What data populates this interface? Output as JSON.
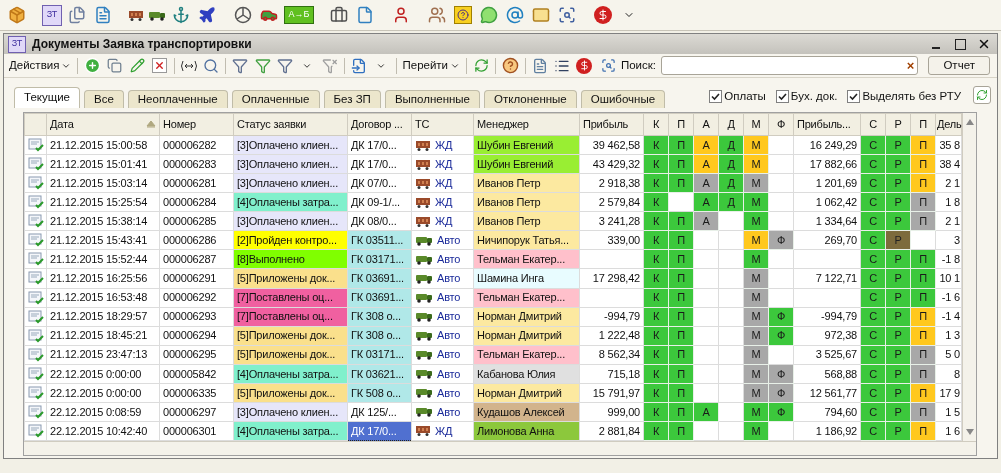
{
  "app_toolbar": {
    "doc_icon_label": "ЗТ",
    "route_icon_label": "А→Б"
  },
  "window": {
    "icon_label": "ЗТ",
    "title": "Документы Заявка транспортировки"
  },
  "toolbar": {
    "actions_menu": "Действия",
    "goto_menu": "Перейти",
    "search_label": "Поиск:",
    "search_clear": "×",
    "report_button": "Отчет"
  },
  "tabs": [
    {
      "label": "Текущие",
      "selected": true
    },
    {
      "label": "Все",
      "selected": false
    },
    {
      "label": "Неоплаченные",
      "selected": false
    },
    {
      "label": "Оплаченные",
      "selected": false
    },
    {
      "label": "Без ЗП",
      "selected": false
    },
    {
      "label": "Выполненные",
      "selected": false
    },
    {
      "label": "Отклоненные",
      "selected": false
    },
    {
      "label": "Ошибочные",
      "selected": false
    }
  ],
  "options": [
    {
      "label": "Оплаты",
      "checked": true
    },
    {
      "label": "Бух. док.",
      "checked": true
    },
    {
      "label": "Выделять без РТУ",
      "checked": true
    }
  ],
  "table": {
    "columns": [
      "Дата",
      "Номер",
      "Статус заявки",
      "Договор ...",
      "ТС",
      "Менеджер",
      "Прибыль",
      "К",
      "П",
      "А",
      "Д",
      "М",
      "Ф",
      "Прибыль...",
      "С",
      "Р",
      "П",
      "Дель"
    ],
    "rows": [
      {
        "date": "21.12.2015 15:00:58",
        "number": "000006282",
        "status": {
          "text": "[3]Оплачено клиен...",
          "color": "#e6e6fa"
        },
        "contract": {
          "text": "ДК 17/0...",
          "color": "#ffffff"
        },
        "transport": {
          "kind": "rail",
          "text": "ЖД"
        },
        "manager": {
          "text": "Шубин Евгений",
          "color": "#99ee33"
        },
        "profit": "39 462,58",
        "flags": [
          {
            "on": true,
            "text": "К",
            "color": "#3cc83c"
          },
          {
            "on": true,
            "text": "П",
            "color": "#3cc83c"
          },
          {
            "on": true,
            "text": "А",
            "color": "#ffc81e"
          },
          {
            "on": true,
            "text": "Д",
            "color": "#3cc83c"
          },
          {
            "on": true,
            "text": "М",
            "color": "#ffc81e"
          },
          {
            "on": false
          }
        ],
        "profit_2": "16 249,29",
        "flags_2": [
          {
            "on": true,
            "text": "С",
            "color": "#3cc83c"
          },
          {
            "on": true,
            "text": "Р",
            "color": "#3cc83c"
          },
          {
            "on": true,
            "text": "П",
            "color": "#ffc81e"
          }
        ],
        "last_column": "35 8",
        "selected": false
      },
      {
        "date": "21.12.2015 15:01:41",
        "number": "000006283",
        "status": {
          "text": "[3]Оплачено клиен...",
          "color": "#e6e6fa"
        },
        "contract": {
          "text": "ДК 17/0...",
          "color": "#ffffff"
        },
        "transport": {
          "kind": "rail",
          "text": "ЖД"
        },
        "manager": {
          "text": "Шубин Евгений",
          "color": "#99ee33"
        },
        "profit": "43 429,32",
        "flags": [
          {
            "on": true,
            "text": "К",
            "color": "#3cc83c"
          },
          {
            "on": true,
            "text": "П",
            "color": "#3cc83c"
          },
          {
            "on": true,
            "text": "А",
            "color": "#ffc81e"
          },
          {
            "on": true,
            "text": "Д",
            "color": "#3cc83c"
          },
          {
            "on": true,
            "text": "М",
            "color": "#ffc81e"
          },
          {
            "on": false
          }
        ],
        "profit_2": "17 882,66",
        "flags_2": [
          {
            "on": true,
            "text": "С",
            "color": "#3cc83c"
          },
          {
            "on": true,
            "text": "Р",
            "color": "#3cc83c"
          },
          {
            "on": true,
            "text": "П",
            "color": "#ffc81e"
          }
        ],
        "last_column": "38 4",
        "selected": false
      },
      {
        "date": "21.12.2015 15:03:14",
        "number": "000006281",
        "status": {
          "text": "[3]Оплачено клиен...",
          "color": "#e6e6fa"
        },
        "contract": {
          "text": "ДК 07/0...",
          "color": "#ffffff"
        },
        "transport": {
          "kind": "rail",
          "text": "ЖД"
        },
        "manager": {
          "text": "Иванов Петр",
          "color": "#fce9a0"
        },
        "profit": "2 918,38",
        "flags": [
          {
            "on": true,
            "text": "К",
            "color": "#3cc83c"
          },
          {
            "on": true,
            "text": "П",
            "color": "#3cc83c"
          },
          {
            "on": true,
            "text": "А",
            "color": "#a8a8a8"
          },
          {
            "on": true,
            "text": "Д",
            "color": "#3cc83c"
          },
          {
            "on": true,
            "text": "М",
            "color": "#a8a8a8"
          },
          {
            "on": false
          }
        ],
        "profit_2": "1 201,69",
        "flags_2": [
          {
            "on": true,
            "text": "С",
            "color": "#3cc83c"
          },
          {
            "on": true,
            "text": "Р",
            "color": "#3cc83c"
          },
          {
            "on": true,
            "text": "П",
            "color": "#ffc81e"
          }
        ],
        "last_column": "2 1",
        "selected": false
      },
      {
        "date": "21.12.2015 15:25:54",
        "number": "000006284",
        "status": {
          "text": "[4]Оплачены затра...",
          "color": "#80f0cc"
        },
        "contract": {
          "text": "ДК 09-1/...",
          "color": "#ffffff"
        },
        "transport": {
          "kind": "rail",
          "text": "ЖД"
        },
        "manager": {
          "text": "Иванов Петр",
          "color": "#fce9a0"
        },
        "profit": "2 579,84",
        "flags": [
          {
            "on": true,
            "text": "К",
            "color": "#3cc83c"
          },
          {
            "on": false
          },
          {
            "on": true,
            "text": "А",
            "color": "#3cc83c"
          },
          {
            "on": true,
            "text": "Д",
            "color": "#3cc83c"
          },
          {
            "on": true,
            "text": "М",
            "color": "#3cc83c"
          },
          {
            "on": false
          }
        ],
        "profit_2": "1 062,42",
        "flags_2": [
          {
            "on": true,
            "text": "С",
            "color": "#3cc83c"
          },
          {
            "on": true,
            "text": "Р",
            "color": "#3cc83c"
          },
          {
            "on": true,
            "text": "П",
            "color": "#a8a8a8"
          }
        ],
        "last_column": "1 8",
        "selected": false
      },
      {
        "date": "21.12.2015 15:38:14",
        "number": "000006285",
        "status": {
          "text": "[3]Оплачено клиен...",
          "color": "#e6e6fa"
        },
        "contract": {
          "text": "ДК 08/0...",
          "color": "#ffffff"
        },
        "transport": {
          "kind": "rail",
          "text": "ЖД"
        },
        "manager": {
          "text": "Иванов Петр",
          "color": "#fce9a0"
        },
        "profit": "3 241,28",
        "flags": [
          {
            "on": true,
            "text": "К",
            "color": "#3cc83c"
          },
          {
            "on": true,
            "text": "П",
            "color": "#3cc83c"
          },
          {
            "on": true,
            "text": "А",
            "color": "#a8a8a8"
          },
          {
            "on": false
          },
          {
            "on": true,
            "text": "М",
            "color": "#3cc83c"
          },
          {
            "on": false
          }
        ],
        "profit_2": "1 334,64",
        "flags_2": [
          {
            "on": true,
            "text": "С",
            "color": "#3cc83c"
          },
          {
            "on": true,
            "text": "Р",
            "color": "#3cc83c"
          },
          {
            "on": true,
            "text": "П",
            "color": "#a8a8a8"
          }
        ],
        "last_column": "2 1",
        "selected": false
      },
      {
        "date": "21.12.2015 15:43:41",
        "number": "000006286",
        "status": {
          "text": "[2]Пройден контро...",
          "color": "#ffff00"
        },
        "contract": {
          "text": "ГК 03511...",
          "color": "#b0e8e8"
        },
        "transport": {
          "kind": "truck",
          "text": "Авто"
        },
        "manager": {
          "text": "Ничипорук Татья...",
          "color": "#fce9a0"
        },
        "profit": "339,00",
        "flags": [
          {
            "on": true,
            "text": "К",
            "color": "#3cc83c"
          },
          {
            "on": true,
            "text": "П",
            "color": "#3cc83c"
          },
          {
            "on": false
          },
          {
            "on": false
          },
          {
            "on": true,
            "text": "М",
            "color": "#ffc81e"
          },
          {
            "on": true,
            "text": "Ф",
            "color": "#a8a8a8"
          }
        ],
        "profit_2": "269,70",
        "flags_2": [
          {
            "on": true,
            "text": "С",
            "color": "#3cc83c"
          },
          {
            "on": true,
            "text": "Р",
            "color": "#7d6b3c"
          },
          {
            "on": false
          }
        ],
        "last_column": "3",
        "selected": false
      },
      {
        "date": "21.12.2015 15:52:44",
        "number": "000006287",
        "status": {
          "text": "[8]Выполнено",
          "color": "#80ff00"
        },
        "contract": {
          "text": "ГК 03171...",
          "color": "#b0e8e8"
        },
        "transport": {
          "kind": "truck",
          "text": "Авто"
        },
        "manager": {
          "text": "Тельман Екатер...",
          "color": "#ffc0cb"
        },
        "flags": [
          {
            "on": true,
            "text": "К",
            "color": "#3cc83c"
          },
          {
            "on": true,
            "text": "П",
            "color": "#3cc83c"
          },
          {
            "on": false
          },
          {
            "on": false
          },
          {
            "on": true,
            "text": "М",
            "color": "#3cc83c"
          },
          {
            "on": false
          }
        ],
        "flags_2": [
          {
            "on": true,
            "text": "С",
            "color": "#3cc83c"
          },
          {
            "on": true,
            "text": "Р",
            "color": "#3cc83c"
          },
          {
            "on": true,
            "text": "П",
            "color": "#3cc83c"
          }
        ],
        "last_column": "-1 8",
        "selected": false
      },
      {
        "date": "21.12.2015 16:25:56",
        "number": "000006291",
        "status": {
          "text": "[5]Приложены док...",
          "color": "#fae08c"
        },
        "contract": {
          "text": "ГК 03691...",
          "color": "#b0e8e8"
        },
        "transport": {
          "kind": "truck",
          "text": "Авто"
        },
        "manager": {
          "text": "Шамина Инга",
          "color": "#e8fcff"
        },
        "profit": "17 298,42",
        "flags": [
          {
            "on": true,
            "text": "К",
            "color": "#3cc83c"
          },
          {
            "on": true,
            "text": "П",
            "color": "#3cc83c"
          },
          {
            "on": false
          },
          {
            "on": false
          },
          {
            "on": true,
            "text": "М",
            "color": "#a8a8a8"
          },
          {
            "on": false
          }
        ],
        "profit_2": "7 122,71",
        "flags_2": [
          {
            "on": true,
            "text": "С",
            "color": "#3cc83c"
          },
          {
            "on": true,
            "text": "Р",
            "color": "#3cc83c"
          },
          {
            "on": true,
            "text": "П",
            "color": "#3cc83c"
          }
        ],
        "last_column": "10 1",
        "selected": false
      },
      {
        "date": "21.12.2015 16:53:48",
        "number": "000006292",
        "status": {
          "text": "[7]Поставлены оц...",
          "color": "#f060a0"
        },
        "contract": {
          "text": "ГК 03691...",
          "color": "#b0e8e8"
        },
        "transport": {
          "kind": "truck",
          "text": "Авто"
        },
        "manager": {
          "text": "Тельман Екатер...",
          "color": "#ffc0cb"
        },
        "flags": [
          {
            "on": true,
            "text": "К",
            "color": "#3cc83c"
          },
          {
            "on": true,
            "text": "П",
            "color": "#3cc83c"
          },
          {
            "on": false
          },
          {
            "on": false
          },
          {
            "on": true,
            "text": "М",
            "color": "#a8a8a8"
          },
          {
            "on": false
          }
        ],
        "flags_2": [
          {
            "on": true,
            "text": "С",
            "color": "#3cc83c"
          },
          {
            "on": true,
            "text": "Р",
            "color": "#3cc83c"
          },
          {
            "on": true,
            "text": "П",
            "color": "#3cc83c"
          }
        ],
        "last_column": "-1 6",
        "selected": false
      },
      {
        "date": "21.12.2015 18:29:57",
        "number": "000006293",
        "status": {
          "text": "[7]Поставлены оц...",
          "color": "#f060a0"
        },
        "contract": {
          "text": "ГК 308 о...",
          "color": "#b0e8e8"
        },
        "transport": {
          "kind": "truck",
          "text": "Авто"
        },
        "manager": {
          "text": "Норман Дмитрий",
          "color": "#fce9a0"
        },
        "profit": "-994,79",
        "flags": [
          {
            "on": true,
            "text": "К",
            "color": "#3cc83c"
          },
          {
            "on": true,
            "text": "П",
            "color": "#3cc83c"
          },
          {
            "on": false
          },
          {
            "on": false
          },
          {
            "on": true,
            "text": "М",
            "color": "#a8a8a8"
          },
          {
            "on": true,
            "text": "Ф",
            "color": "#3cc83c"
          }
        ],
        "profit_2": "-994,79",
        "flags_2": [
          {
            "on": true,
            "text": "С",
            "color": "#3cc83c"
          },
          {
            "on": true,
            "text": "Р",
            "color": "#3cc83c"
          },
          {
            "on": true,
            "text": "П",
            "color": "#ffc81e"
          }
        ],
        "last_column": "-1 4",
        "selected": false
      },
      {
        "date": "21.12.2015 18:45:21",
        "number": "000006294",
        "status": {
          "text": "[5]Приложены док...",
          "color": "#fae08c"
        },
        "contract": {
          "text": "ГК 308 о...",
          "color": "#b0e8e8"
        },
        "transport": {
          "kind": "truck",
          "text": "Авто"
        },
        "manager": {
          "text": "Норман Дмитрий",
          "color": "#fce9a0"
        },
        "profit": "1 222,48",
        "flags": [
          {
            "on": true,
            "text": "К",
            "color": "#3cc83c"
          },
          {
            "on": true,
            "text": "П",
            "color": "#3cc83c"
          },
          {
            "on": false
          },
          {
            "on": false
          },
          {
            "on": true,
            "text": "М",
            "color": "#a8a8a8"
          },
          {
            "on": true,
            "text": "Ф",
            "color": "#3cc83c"
          }
        ],
        "profit_2": "972,38",
        "flags_2": [
          {
            "on": true,
            "text": "С",
            "color": "#3cc83c"
          },
          {
            "on": true,
            "text": "Р",
            "color": "#3cc83c"
          },
          {
            "on": true,
            "text": "П",
            "color": "#ffc81e"
          }
        ],
        "last_column": "1 3",
        "selected": false
      },
      {
        "date": "21.12.2015 23:47:13",
        "number": "000006295",
        "status": {
          "text": "[5]Приложены док...",
          "color": "#fae08c"
        },
        "contract": {
          "text": "ГК 03171...",
          "color": "#b0e8e8"
        },
        "transport": {
          "kind": "truck",
          "text": "Авто"
        },
        "manager": {
          "text": "Тельман Екатер...",
          "color": "#ffc0cb"
        },
        "profit": "8 562,34",
        "flags": [
          {
            "on": true,
            "text": "К",
            "color": "#3cc83c"
          },
          {
            "on": true,
            "text": "П",
            "color": "#3cc83c"
          },
          {
            "on": false
          },
          {
            "on": false
          },
          {
            "on": true,
            "text": "М",
            "color": "#a8a8a8"
          },
          {
            "on": false
          }
        ],
        "profit_2": "3 525,67",
        "flags_2": [
          {
            "on": true,
            "text": "С",
            "color": "#3cc83c"
          },
          {
            "on": true,
            "text": "Р",
            "color": "#3cc83c"
          },
          {
            "on": true,
            "text": "П",
            "color": "#a8a8a8"
          }
        ],
        "last_column": "5 0",
        "selected": false
      },
      {
        "date": "22.12.2015 0:00:00",
        "number": "000005842",
        "status": {
          "text": "[4]Оплачены затра...",
          "color": "#80f0cc"
        },
        "contract": {
          "text": "ГК 03621...",
          "color": "#b0e8e8"
        },
        "transport": {
          "kind": "truck",
          "text": "Авто"
        },
        "manager": {
          "text": "Кабанова Юлия",
          "color": "#e0e0e0"
        },
        "profit": "715,18",
        "flags": [
          {
            "on": true,
            "text": "К",
            "color": "#3cc83c"
          },
          {
            "on": true,
            "text": "П",
            "color": "#3cc83c"
          },
          {
            "on": false
          },
          {
            "on": false
          },
          {
            "on": true,
            "text": "М",
            "color": "#a8a8a8"
          },
          {
            "on": true,
            "text": "Ф",
            "color": "#a8a8a8"
          }
        ],
        "profit_2": "568,88",
        "flags_2": [
          {
            "on": true,
            "text": "С",
            "color": "#3cc83c"
          },
          {
            "on": true,
            "text": "Р",
            "color": "#3cc83c"
          },
          {
            "on": true,
            "text": "П",
            "color": "#a8a8a8"
          }
        ],
        "last_column": "8",
        "selected": false
      },
      {
        "date": "22.12.2015 0:00:00",
        "number": "000006335",
        "status": {
          "text": "[5]Приложены док...",
          "color": "#fae08c"
        },
        "contract": {
          "text": "ГК 508 о...",
          "color": "#b0e8e8"
        },
        "transport": {
          "kind": "truck",
          "text": "Авто"
        },
        "manager": {
          "text": "Норман Дмитрий",
          "color": "#fce9a0"
        },
        "profit": "15 791,97",
        "flags": [
          {
            "on": true,
            "text": "К",
            "color": "#3cc83c"
          },
          {
            "on": true,
            "text": "П",
            "color": "#3cc83c"
          },
          {
            "on": false
          },
          {
            "on": false
          },
          {
            "on": true,
            "text": "М",
            "color": "#a8a8a8"
          },
          {
            "on": true,
            "text": "Ф",
            "color": "#a8a8a8"
          }
        ],
        "profit_2": "12 561,77",
        "flags_2": [
          {
            "on": true,
            "text": "С",
            "color": "#3cc83c"
          },
          {
            "on": true,
            "text": "Р",
            "color": "#3cc83c"
          },
          {
            "on": true,
            "text": "П",
            "color": "#ffc81e"
          }
        ],
        "last_column": "17 9",
        "selected": false
      },
      {
        "date": "22.12.2015 0:08:59",
        "number": "000006297",
        "status": {
          "text": "[3]Оплачено клиен...",
          "color": "#e6e6fa"
        },
        "contract": {
          "text": "ДК 125/...",
          "color": "#ffffff"
        },
        "transport": {
          "kind": "truck",
          "text": "Авто"
        },
        "manager": {
          "text": "Кудашов Алексей",
          "color": "#d2b48c"
        },
        "profit": "999,00",
        "flags": [
          {
            "on": true,
            "text": "К",
            "color": "#3cc83c"
          },
          {
            "on": true,
            "text": "П",
            "color": "#3cc83c"
          },
          {
            "on": true,
            "text": "А",
            "color": "#3cc83c"
          },
          {
            "on": false
          },
          {
            "on": true,
            "text": "М",
            "color": "#3cc83c"
          },
          {
            "on": true,
            "text": "Ф",
            "color": "#3cc83c"
          }
        ],
        "profit_2": "794,60",
        "flags_2": [
          {
            "on": true,
            "text": "С",
            "color": "#3cc83c"
          },
          {
            "on": true,
            "text": "Р",
            "color": "#3cc83c"
          },
          {
            "on": true,
            "text": "П",
            "color": "#a8a8a8"
          }
        ],
        "last_column": "1 5",
        "selected": false
      },
      {
        "date": "22.12.2015 10:42:40",
        "number": "000006301",
        "status": {
          "text": "[4]Оплачены затра...",
          "color": "#80f0cc"
        },
        "contract": {
          "text": "ДК 17/0...",
          "color": "#5070d0"
        },
        "transport": {
          "kind": "rail",
          "text": "ЖД"
        },
        "manager": {
          "text": "Лимонова Анна",
          "color": "#8cc83c"
        },
        "profit": "2 881,84",
        "flags": [
          {
            "on": true,
            "text": "К",
            "color": "#3cc83c"
          },
          {
            "on": true,
            "text": "П",
            "color": "#3cc83c"
          },
          {
            "on": false
          },
          {
            "on": false
          },
          {
            "on": true,
            "text": "М",
            "color": "#3cc83c"
          },
          {
            "on": false
          }
        ],
        "profit_2": "1 186,92",
        "flags_2": [
          {
            "on": true,
            "text": "С",
            "color": "#3cc83c"
          },
          {
            "on": true,
            "text": "Р",
            "color": "#3cc83c"
          },
          {
            "on": true,
            "text": "П",
            "color": "#ffc81e"
          }
        ],
        "last_column": "1 6",
        "selected": true
      }
    ]
  }
}
